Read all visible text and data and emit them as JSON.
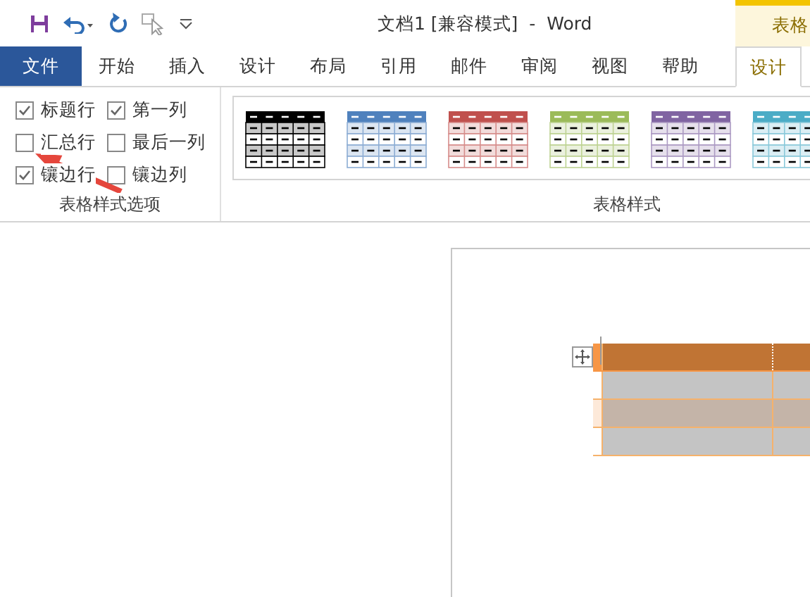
{
  "window": {
    "title": "文档1 [兼容模式]  -  Word"
  },
  "context_tab_header": "表格",
  "tabs": [
    {
      "label": "文件",
      "kind": "file",
      "selected": false
    },
    {
      "label": "开始",
      "kind": "normal",
      "selected": false
    },
    {
      "label": "插入",
      "kind": "normal",
      "selected": false
    },
    {
      "label": "设计",
      "kind": "normal",
      "selected": false
    },
    {
      "label": "布局",
      "kind": "normal",
      "selected": false
    },
    {
      "label": "引用",
      "kind": "normal",
      "selected": false
    },
    {
      "label": "邮件",
      "kind": "normal",
      "selected": false
    },
    {
      "label": "审阅",
      "kind": "normal",
      "selected": false
    },
    {
      "label": "视图",
      "kind": "normal",
      "selected": false
    },
    {
      "label": "帮助",
      "kind": "normal",
      "selected": false
    },
    {
      "label": "设计",
      "kind": "context",
      "selected": true
    }
  ],
  "style_options": {
    "label": "表格样式选项",
    "options": [
      {
        "label": "标题行",
        "checked": true
      },
      {
        "label": "第一列",
        "checked": true
      },
      {
        "label": "汇总行",
        "checked": false
      },
      {
        "label": "最后一列",
        "checked": false
      },
      {
        "label": "镶边行",
        "checked": true
      },
      {
        "label": "镶边列",
        "checked": false
      }
    ]
  },
  "table_styles": {
    "label": "表格样式",
    "styles": [
      {
        "color": "#000000"
      },
      {
        "color": "#4f81bd"
      },
      {
        "color": "#c0504d"
      },
      {
        "color": "#9bbb59"
      },
      {
        "color": "#8064a2"
      },
      {
        "color": "#4bacc6"
      }
    ]
  }
}
